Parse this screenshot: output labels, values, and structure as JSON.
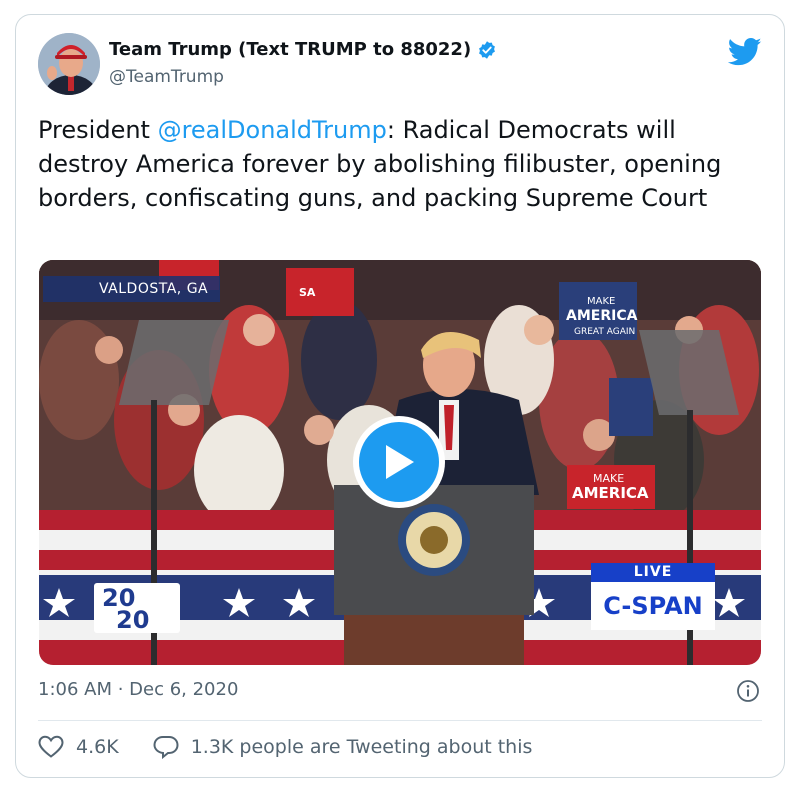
{
  "tweet": {
    "display_name": "Team Trump (Text TRUMP to 88022)",
    "handle": "@TeamTrump",
    "text_prefix": "President ",
    "mention": "@realDonaldTrump",
    "text_suffix": ": Radical Democrats will destroy America forever by abolishing filibuster, opening borders, confiscating guns, and packing Supreme Court",
    "timestamp": "1:06 AM · Dec 6, 2020",
    "likes": "4.6K",
    "conversation": "1.3K people are Tweeting about this"
  },
  "media": {
    "location_tag": "VALDOSTA, GA",
    "live_label": "LIVE",
    "network_label": "C-SPAN",
    "year_logo_top": "20",
    "year_logo_bottom": "20",
    "signs": [
      "MAKE",
      "AMERICA",
      "GREAT AGAIN"
    ]
  },
  "colors": {
    "accent": "#1d9bf0",
    "secondary_text": "#536471",
    "border": "#cfd9de"
  },
  "icons": [
    "verified-badge-icon",
    "twitter-bird-icon",
    "play-icon",
    "info-icon",
    "heart-icon",
    "speech-bubble-icon"
  ]
}
